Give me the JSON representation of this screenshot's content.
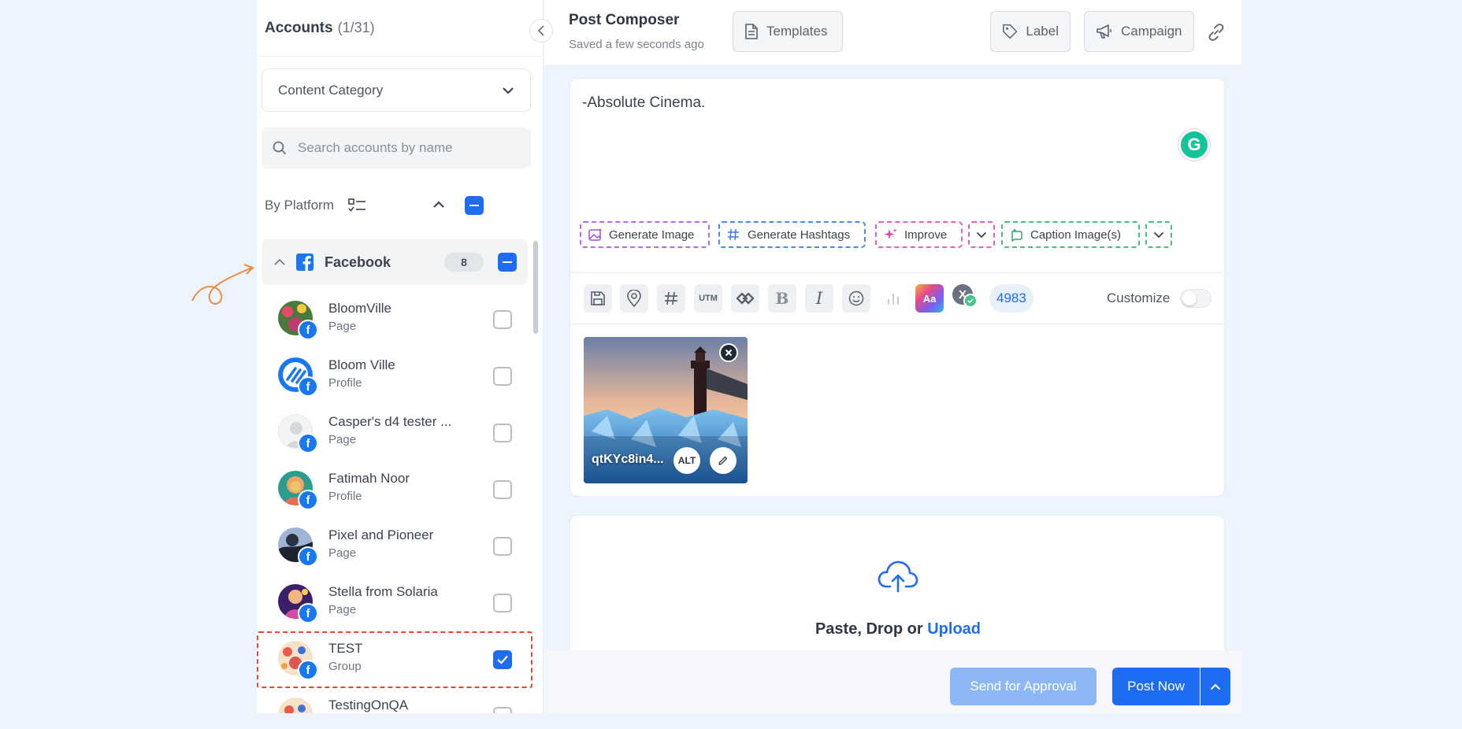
{
  "accounts": {
    "title": "Accounts",
    "count": "(1/31)",
    "category_select": "Content Category",
    "search_placeholder": "Search accounts by name",
    "by_platform_label": "By Platform",
    "platform_group": {
      "name": "Facebook",
      "count": "8"
    },
    "items": [
      {
        "name": "BloomVille",
        "type": "Page",
        "checked": false
      },
      {
        "name": "Bloom Ville",
        "type": "Profile",
        "checked": false
      },
      {
        "name": "Casper's d4 tester ...",
        "type": "Page",
        "checked": false
      },
      {
        "name": "Fatimah Noor",
        "type": "Profile",
        "checked": false
      },
      {
        "name": "Pixel and Pioneer",
        "type": "Page",
        "checked": false
      },
      {
        "name": "Stella from Solaria",
        "type": "Page",
        "checked": false
      },
      {
        "name": "TEST",
        "type": "Group",
        "checked": true
      },
      {
        "name": "TestingOnQA",
        "type": "",
        "checked": false
      }
    ]
  },
  "composer": {
    "title": "Post Composer",
    "saved_status": "Saved a few seconds ago",
    "templates_label": "Templates",
    "label_label": "Label",
    "campaign_label": "Campaign",
    "post_text": "-Absolute Cinema.",
    "ai_actions": {
      "generate_image": "Generate Image",
      "generate_hashtags": "Generate Hashtags",
      "improve": "Improve",
      "caption_images": "Caption Image(s)"
    },
    "toolbar": {
      "utm": "UTM",
      "format_label": "Aa",
      "char_count": "4983",
      "customize_label": "Customize"
    },
    "media": {
      "file_name": "qtKYc8in4...",
      "alt_label": "ALT"
    },
    "upload": {
      "prefix": "Paste, Drop or ",
      "link": "Upload"
    },
    "actions": {
      "send_for_approval": "Send for Approval",
      "post_now": "Post Now"
    }
  },
  "colors": {
    "accent": "#1e6cf2",
    "facebook": "#1877f2",
    "highlight": "#f07a2d"
  }
}
